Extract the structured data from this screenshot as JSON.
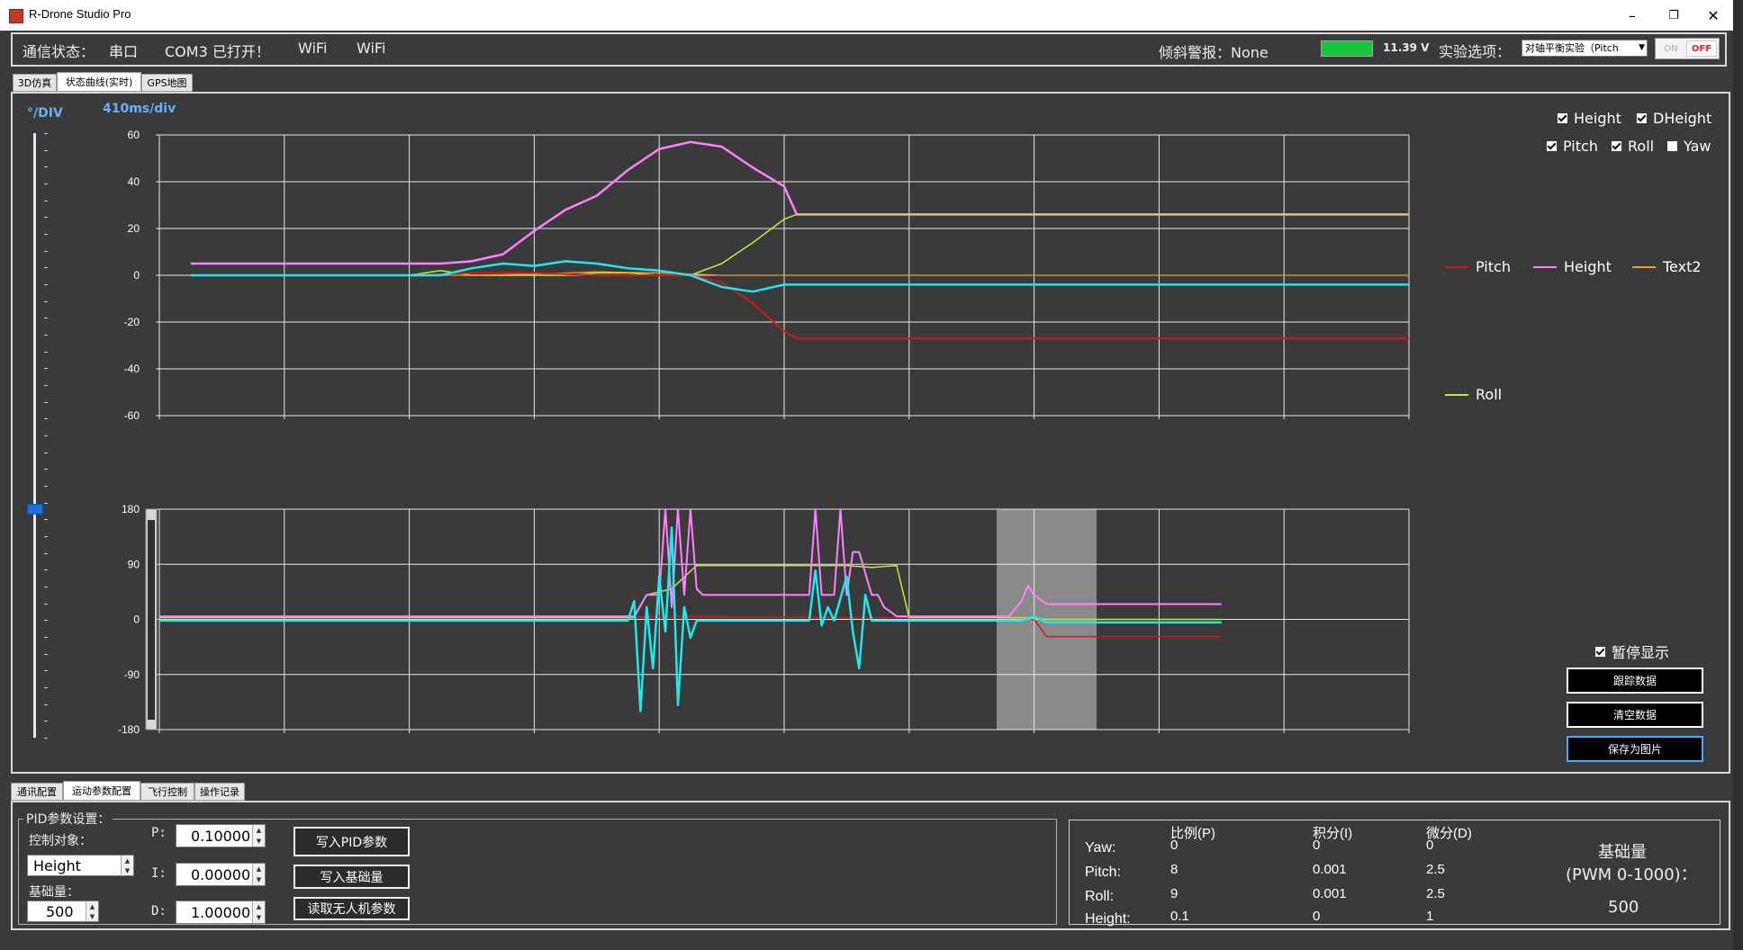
{
  "window": {
    "title": "R-Drone Studio  Pro",
    "minimize": "–",
    "maximize": "❐",
    "close": "✕"
  },
  "status": {
    "comm_label": "通信状态：",
    "mode": "串口",
    "port": "COM3 已打开！",
    "wifi1": "WiFi",
    "wifi2": "WiFi",
    "tilt_alarm": "倾斜警报：None",
    "battery": "11.39 V",
    "battery_level": 1.0,
    "battery_color": "#17c43a",
    "experiment_label": "实验选项：",
    "experiment_value": "对轴平衡实验（Pitch",
    "toggle_on": "ON",
    "toggle_off": "OFF"
  },
  "top_tabs": [
    "3D仿真",
    "状态曲线(实时)",
    "GPS地图"
  ],
  "top_tab_active": 1,
  "chart_panel": {
    "div_label": "°/DIV",
    "time_div": "410ms/div",
    "checkboxes": [
      {
        "label": "Height",
        "checked": true
      },
      {
        "label": "DHeight",
        "checked": true
      },
      {
        "label": "Pitch",
        "checked": true
      },
      {
        "label": "Roll",
        "checked": true
      },
      {
        "label": "Yaw",
        "checked": false
      }
    ],
    "legend": [
      {
        "name": "Pitch",
        "color": "#d01a1a"
      },
      {
        "name": "Height",
        "color": "#ff80ff"
      },
      {
        "name": "Text2",
        "color": "#f0a030"
      },
      {
        "name": "Roll",
        "color": "#b8ee3a"
      }
    ],
    "pause_label": "暂停显示",
    "pause_checked": true,
    "btn_track": "跟踪数据",
    "btn_clear": "清空数据",
    "btn_save": "保存为图片",
    "slider_value": 0.62
  },
  "chart_data": [
    {
      "type": "line",
      "ylim": [
        -60,
        60
      ],
      "yticks": [
        60,
        40,
        20,
        0,
        -20,
        -40,
        -60
      ],
      "xlim": [
        0,
        10
      ],
      "series": [
        {
          "name": "Height",
          "color": "#ff80ff",
          "width": 2.5,
          "x": [
            0.25,
            1.0,
            2.0,
            2.25,
            2.5,
            2.75,
            3.0,
            3.25,
            3.5,
            3.75,
            4.0,
            4.25,
            4.5,
            4.75,
            5.0,
            5.1,
            10.0
          ],
          "y": [
            5,
            5,
            5,
            5,
            6,
            9,
            19,
            28,
            34,
            45,
            54,
            57,
            55,
            46,
            38,
            26,
            26
          ]
        },
        {
          "name": "Roll",
          "color": "#b8ee3a",
          "width": 1.5,
          "x": [
            0.25,
            1.0,
            2.0,
            2.25,
            2.5,
            2.75,
            3.0,
            3.25,
            3.5,
            3.75,
            4.0,
            4.25,
            4.5,
            4.75,
            5.0,
            5.1,
            10.0
          ],
          "y": [
            0,
            0,
            0,
            2,
            0,
            0,
            0,
            0,
            1,
            1,
            0,
            0,
            5,
            14,
            24,
            26,
            26
          ]
        },
        {
          "name": "Text2",
          "color": "#f0a030",
          "width": 1.2,
          "x": [
            0.25,
            1.0,
            2.0,
            2.5,
            3.0,
            3.5,
            4.0,
            4.5,
            10.0
          ],
          "y": [
            0,
            0,
            0,
            0,
            0.5,
            1.5,
            1,
            0,
            0
          ]
        },
        {
          "name": "Pitch",
          "color": "#d01a1a",
          "width": 2,
          "x": [
            0.25,
            1.0,
            2.0,
            2.5,
            3.0,
            3.5,
            4.0,
            4.25,
            4.5,
            4.75,
            5.0,
            5.1,
            10.0
          ],
          "y": [
            0,
            0,
            0,
            1,
            1,
            0,
            0,
            0,
            -3,
            -12,
            -24,
            -27,
            -27
          ]
        },
        {
          "name": "DHeight",
          "color": "#1fe8ef",
          "width": 2.5,
          "x": [
            0.25,
            1.0,
            2.0,
            2.25,
            2.5,
            2.75,
            3.0,
            3.25,
            3.5,
            3.75,
            4.0,
            4.25,
            4.5,
            4.75,
            5.0,
            5.1,
            10.0
          ],
          "y": [
            0,
            0,
            0,
            0,
            3,
            5,
            4,
            6,
            5,
            3,
            2,
            0,
            -5,
            -7,
            -4,
            -4,
            -4
          ]
        }
      ]
    },
    {
      "type": "line",
      "ylim": [
        -180,
        180
      ],
      "yticks": [
        180,
        90,
        0,
        -90,
        -180
      ],
      "xlim": [
        0,
        10
      ],
      "highlight": [
        6.7,
        7.5
      ],
      "series": [
        {
          "name": "Pitch",
          "color": "#d01a1a",
          "width": 1.5,
          "x": [
            0,
            3.8,
            4.0,
            5.4,
            6.9,
            7.0,
            7.1,
            8.5
          ],
          "y": [
            3,
            3,
            5,
            3,
            3,
            0,
            -28,
            -28
          ]
        },
        {
          "name": "Roll",
          "color": "#b8ee3a",
          "width": 1.5,
          "x": [
            0,
            3.8,
            3.9,
            4.1,
            4.3,
            4.5,
            5.0,
            5.5,
            5.7,
            5.9,
            6.0,
            6.9,
            7.1,
            8.5
          ],
          "y": [
            3,
            3,
            40,
            50,
            88,
            88,
            88,
            88,
            85,
            88,
            3,
            3,
            0,
            0
          ]
        },
        {
          "name": "Height",
          "color": "#ff80ff",
          "width": 2,
          "x": [
            0,
            3.8,
            3.9,
            4.0,
            4.05,
            4.1,
            4.15,
            4.2,
            4.25,
            4.3,
            4.35,
            4.4,
            4.5,
            5.0,
            5.2,
            5.25,
            5.3,
            5.4,
            5.45,
            5.5,
            5.55,
            5.6,
            5.7,
            5.75,
            5.8,
            5.9,
            6.0,
            6.6,
            6.8,
            6.9,
            6.95,
            7.0,
            7.1,
            8.5
          ],
          "y": [
            5,
            5,
            40,
            40,
            180,
            20,
            180,
            40,
            180,
            50,
            40,
            40,
            40,
            40,
            40,
            180,
            40,
            40,
            180,
            40,
            110,
            110,
            40,
            40,
            20,
            5,
            5,
            5,
            5,
            30,
            55,
            40,
            25,
            25
          ]
        },
        {
          "name": "DHeight",
          "color": "#1fe8ef",
          "width": 2.5,
          "x": [
            0,
            3.75,
            3.8,
            3.85,
            3.9,
            3.95,
            4.0,
            4.05,
            4.1,
            4.15,
            4.2,
            4.25,
            4.3,
            4.35,
            4.4,
            4.45,
            4.5,
            5.0,
            5.2,
            5.25,
            5.3,
            5.35,
            5.4,
            5.5,
            5.55,
            5.6,
            5.65,
            5.7,
            5.75,
            6.0,
            6.9,
            7.0,
            7.1,
            8.5
          ],
          "y": [
            -2,
            -2,
            30,
            -150,
            20,
            -80,
            70,
            -20,
            150,
            -140,
            20,
            -30,
            -2,
            -2,
            -2,
            -2,
            -2,
            -2,
            -2,
            80,
            -10,
            20,
            -2,
            70,
            -20,
            -80,
            40,
            -2,
            -2,
            -2,
            -2,
            5,
            -5,
            -5
          ]
        }
      ]
    }
  ],
  "bottom_tabs": [
    "通讯配置",
    "运动参数配置",
    "飞行控制",
    "操作记录"
  ],
  "bottom_tab_active": 1,
  "pid": {
    "group_label": "PID参数设置：",
    "target_label": "控制对象：",
    "target_value": "Height",
    "base_label": "基础量：",
    "base_value": "500",
    "p_label": "P:",
    "p_value": "0.10000",
    "i_label": "I:",
    "i_value": "0.00000",
    "d_label": "D:",
    "d_value": "1.00000",
    "btn_write_pid": "写入PID参数",
    "btn_write_base": "写入基础量",
    "btn_read": "读取无人机参数"
  },
  "param_table": {
    "headers": [
      "比例(P)",
      "积分(I)",
      "微分(D)"
    ],
    "rows": [
      {
        "name": "Yaw:",
        "p": "0",
        "i": "0",
        "d": "0"
      },
      {
        "name": "Pitch:",
        "p": "8",
        "i": "0.001",
        "d": "2.5"
      },
      {
        "name": "Roll:",
        "p": "9",
        "i": "0.001",
        "d": "2.5"
      },
      {
        "name": "Height:",
        "p": "0.1",
        "i": "0",
        "d": "1"
      }
    ],
    "base_title1": "基础量",
    "base_title2": "(PWM 0-1000)：",
    "base_value": "500"
  }
}
